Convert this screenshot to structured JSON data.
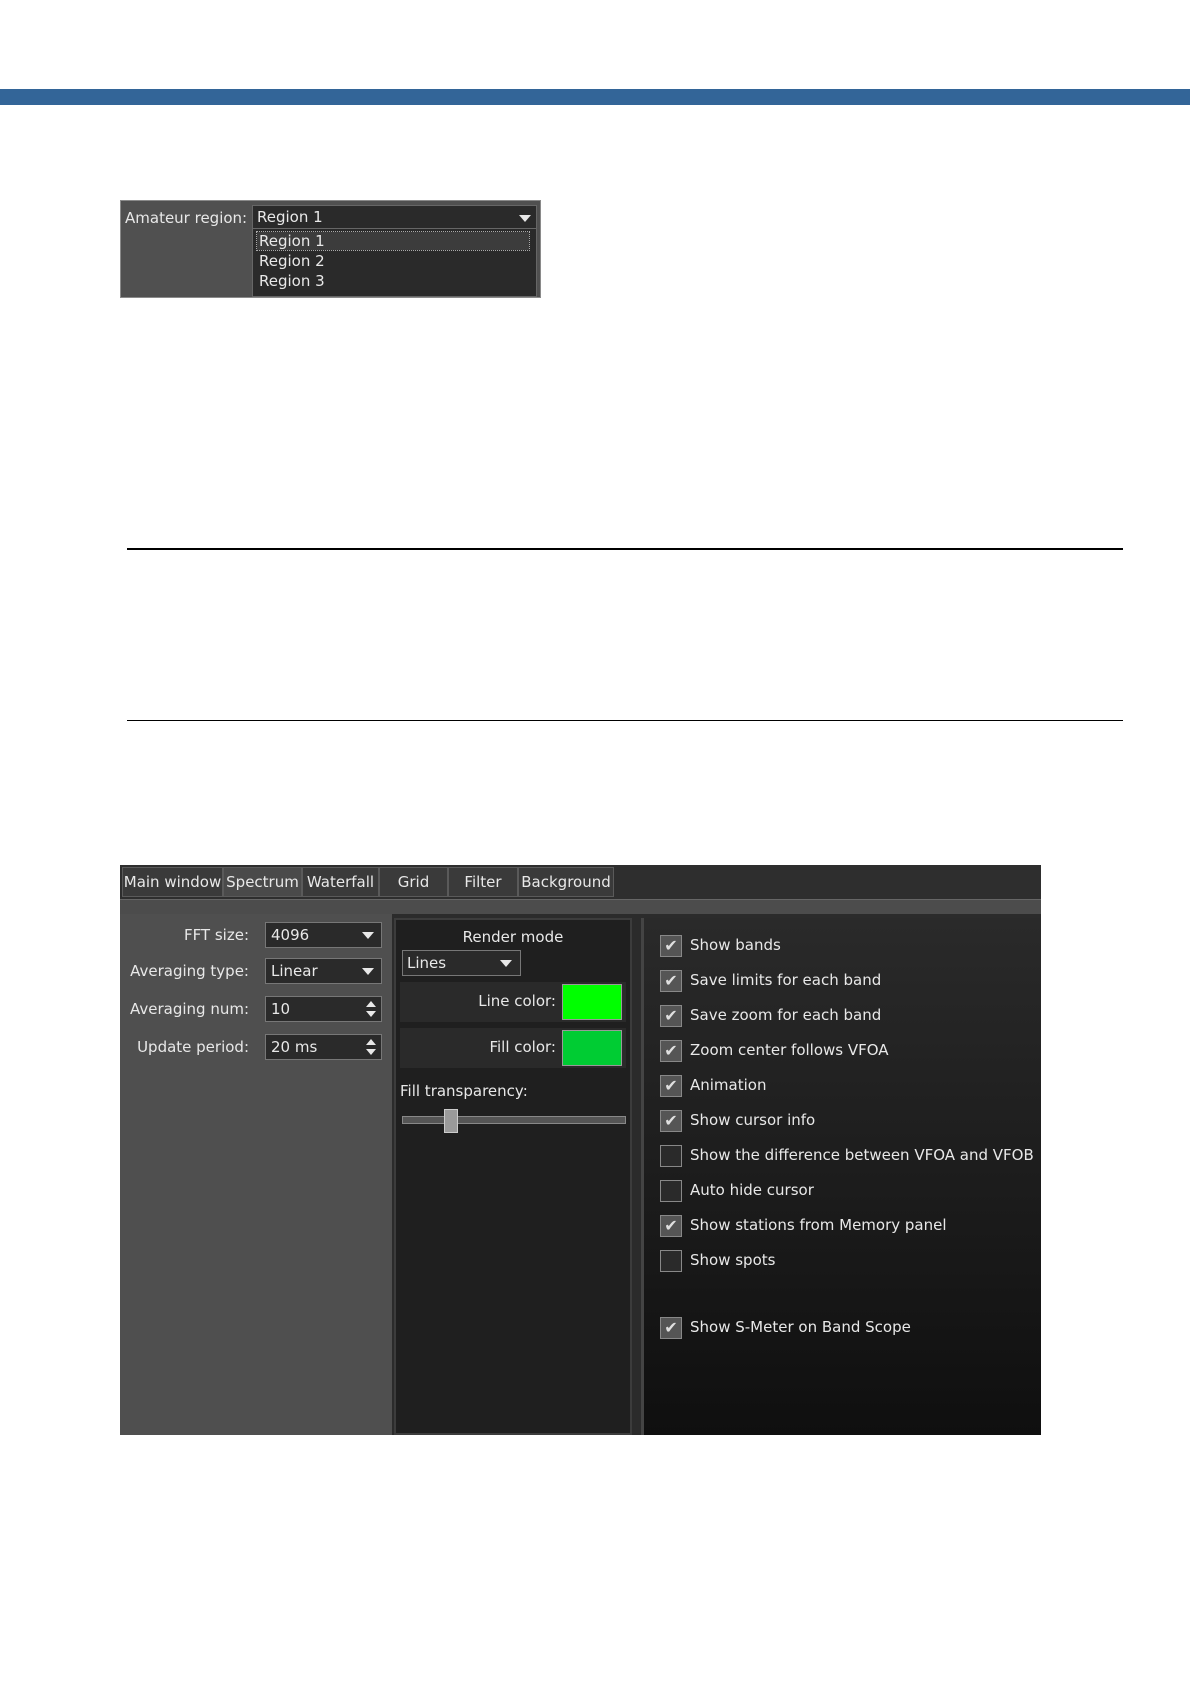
{
  "region_dropdown": {
    "label": "Amateur region:",
    "selected": "Region 1",
    "options": [
      "Region 1",
      "Region 2",
      "Region 3"
    ],
    "highlighted_index": 0
  },
  "settings": {
    "tabs": [
      "Main window",
      "Spectrum",
      "Waterfall",
      "Grid",
      "Filter",
      "Background"
    ],
    "active_tab": "Spectrum",
    "left": {
      "fft_size": {
        "label": "FFT size:",
        "value": "4096"
      },
      "averaging_type": {
        "label": "Averaging type:",
        "value": "Linear"
      },
      "averaging_num": {
        "label": "Averaging num:",
        "value": "10"
      },
      "update_period": {
        "label": "Update period:",
        "value": "20 ms"
      }
    },
    "render": {
      "title": "Render mode",
      "mode": "Lines",
      "line_color": {
        "label": "Line color:",
        "color": "#00ff00"
      },
      "fill_color": {
        "label": "Fill color:",
        "color": "#00cc33"
      },
      "fill_transparency": {
        "label": "Fill transparency:",
        "value": 0.2
      }
    },
    "checkboxes": [
      {
        "label": "Show bands",
        "checked": true
      },
      {
        "label": "Save limits for each band",
        "checked": true
      },
      {
        "label": "Save zoom for each band",
        "checked": true
      },
      {
        "label": "Zoom center follows VFOA",
        "checked": true
      },
      {
        "label": "Animation",
        "checked": true
      },
      {
        "label": "Show cursor info",
        "checked": true
      },
      {
        "label": "Show the difference between VFOA and VFOB",
        "checked": false
      },
      {
        "label": "Auto hide cursor",
        "checked": false
      },
      {
        "label": "Show stations from Memory panel",
        "checked": true
      },
      {
        "label": "Show spots",
        "checked": false
      },
      {
        "label": "Show S-Meter on Band Scope",
        "checked": true
      }
    ]
  },
  "colors": {
    "header_bar": "#336598"
  }
}
